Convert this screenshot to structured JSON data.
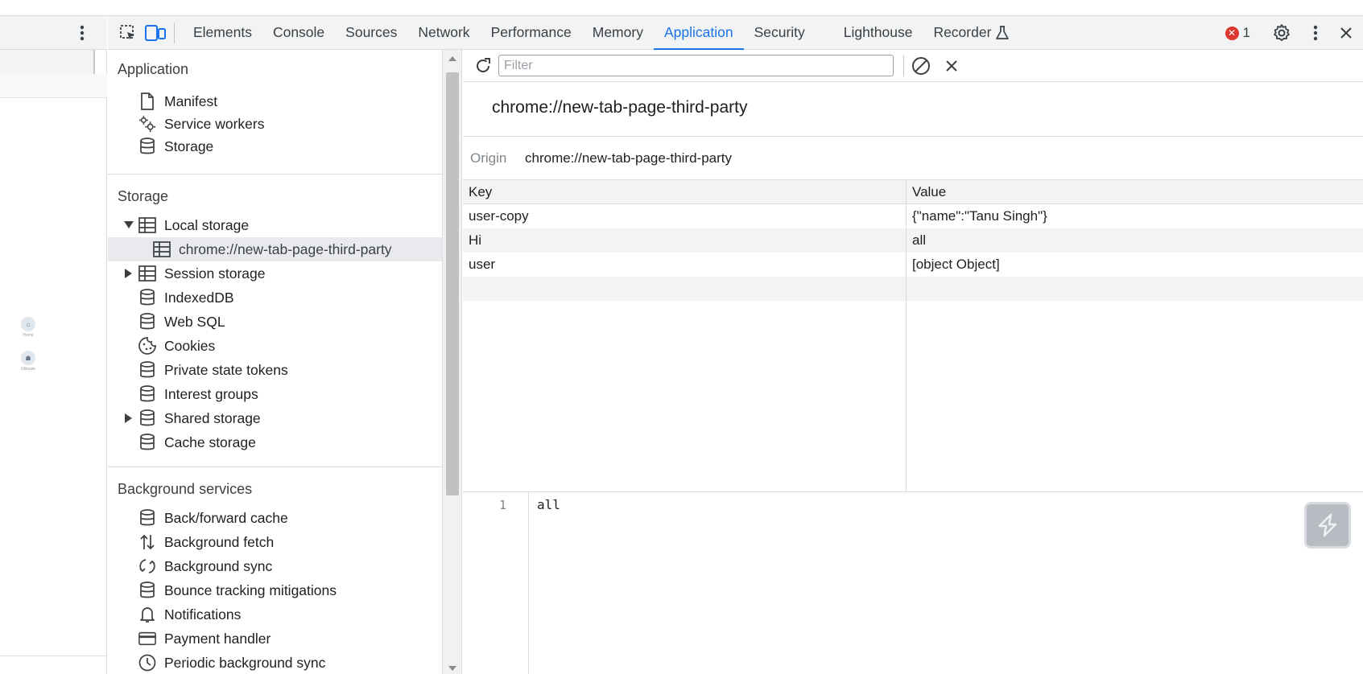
{
  "toolbar": {
    "tabs": [
      {
        "label": "Elements"
      },
      {
        "label": "Console"
      },
      {
        "label": "Sources"
      },
      {
        "label": "Network"
      },
      {
        "label": "Performance"
      },
      {
        "label": "Memory"
      },
      {
        "label": "Application",
        "active": true
      },
      {
        "label": "Security"
      },
      {
        "label": "Lighthouse"
      },
      {
        "label": "Recorder"
      }
    ],
    "error_count": "1"
  },
  "left_page": {
    "apps": [
      {
        "label": "Home"
      },
      {
        "label": "Ultimate"
      }
    ]
  },
  "sidebar": {
    "application": {
      "title": "Application",
      "items": [
        {
          "label": "Manifest",
          "icon": "file-icon"
        },
        {
          "label": "Service workers",
          "icon": "gears-icon"
        },
        {
          "label": "Storage",
          "icon": "database-icon"
        }
      ]
    },
    "storage": {
      "title": "Storage",
      "local_storage": "Local storage",
      "local_storage_child": "chrome://new-tab-page-third-party",
      "session_storage": "Session storage",
      "indexeddb": "IndexedDB",
      "websql": "Web SQL",
      "cookies": "Cookies",
      "private_state_tokens": "Private state tokens",
      "interest_groups": "Interest groups",
      "shared_storage": "Shared storage",
      "cache_storage": "Cache storage"
    },
    "background": {
      "title": "Background services",
      "items": [
        {
          "label": "Back/forward cache",
          "icon": "database-icon"
        },
        {
          "label": "Background fetch",
          "icon": "updown-arrows-icon"
        },
        {
          "label": "Background sync",
          "icon": "sync-icon"
        },
        {
          "label": "Bounce tracking mitigations",
          "icon": "database-icon"
        },
        {
          "label": "Notifications",
          "icon": "bell-icon"
        },
        {
          "label": "Payment handler",
          "icon": "card-icon"
        },
        {
          "label": "Periodic background sync",
          "icon": "clock-icon"
        }
      ]
    }
  },
  "main": {
    "filter_placeholder": "Filter",
    "origin_title": "chrome://new-tab-page-third-party",
    "origin_label": "Origin",
    "origin_value": "chrome://new-tab-page-third-party",
    "columns": {
      "key": "Key",
      "value": "Value"
    },
    "rows": [
      {
        "key": "user-copy",
        "value": "{\"name\":\"Tanu Singh\"}"
      },
      {
        "key": "Hi",
        "value": "all",
        "selected": true
      },
      {
        "key": "user",
        "value": "[object Object]"
      }
    ],
    "preview": {
      "line_number": "1",
      "content": "all"
    }
  },
  "colors": {
    "accent": "#1a73e8",
    "error": "#dc362e"
  }
}
